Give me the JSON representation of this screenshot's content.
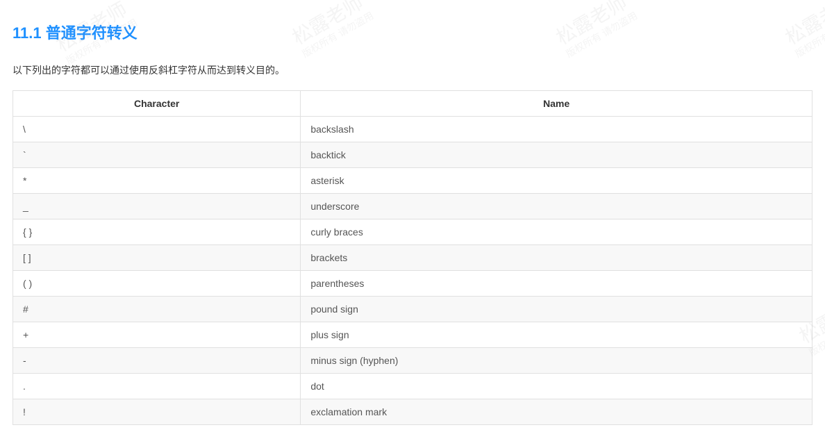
{
  "heading": "11.1 普通字符转义",
  "intro": "以下列出的字符都可以通过使用反斜杠字符从而达到转义目的。",
  "table": {
    "headers": [
      "Character",
      "Name"
    ],
    "rows": [
      {
        "char": "\\",
        "name": "backslash"
      },
      {
        "char": "`",
        "name": "backtick"
      },
      {
        "char": "*",
        "name": "asterisk"
      },
      {
        "char": "_",
        "name": "underscore"
      },
      {
        "char": "{ }",
        "name": "curly braces"
      },
      {
        "char": "[ ]",
        "name": "brackets"
      },
      {
        "char": "( )",
        "name": "parentheses"
      },
      {
        "char": "#",
        "name": "pound sign"
      },
      {
        "char": "+",
        "name": "plus sign"
      },
      {
        "char": "-",
        "name": "minus sign (hyphen)"
      },
      {
        "char": ".",
        "name": "dot"
      },
      {
        "char": "!",
        "name": "exclamation mark"
      }
    ]
  },
  "watermark": {
    "main": "松露老师",
    "sub": "版权所有 请勿盗用"
  }
}
